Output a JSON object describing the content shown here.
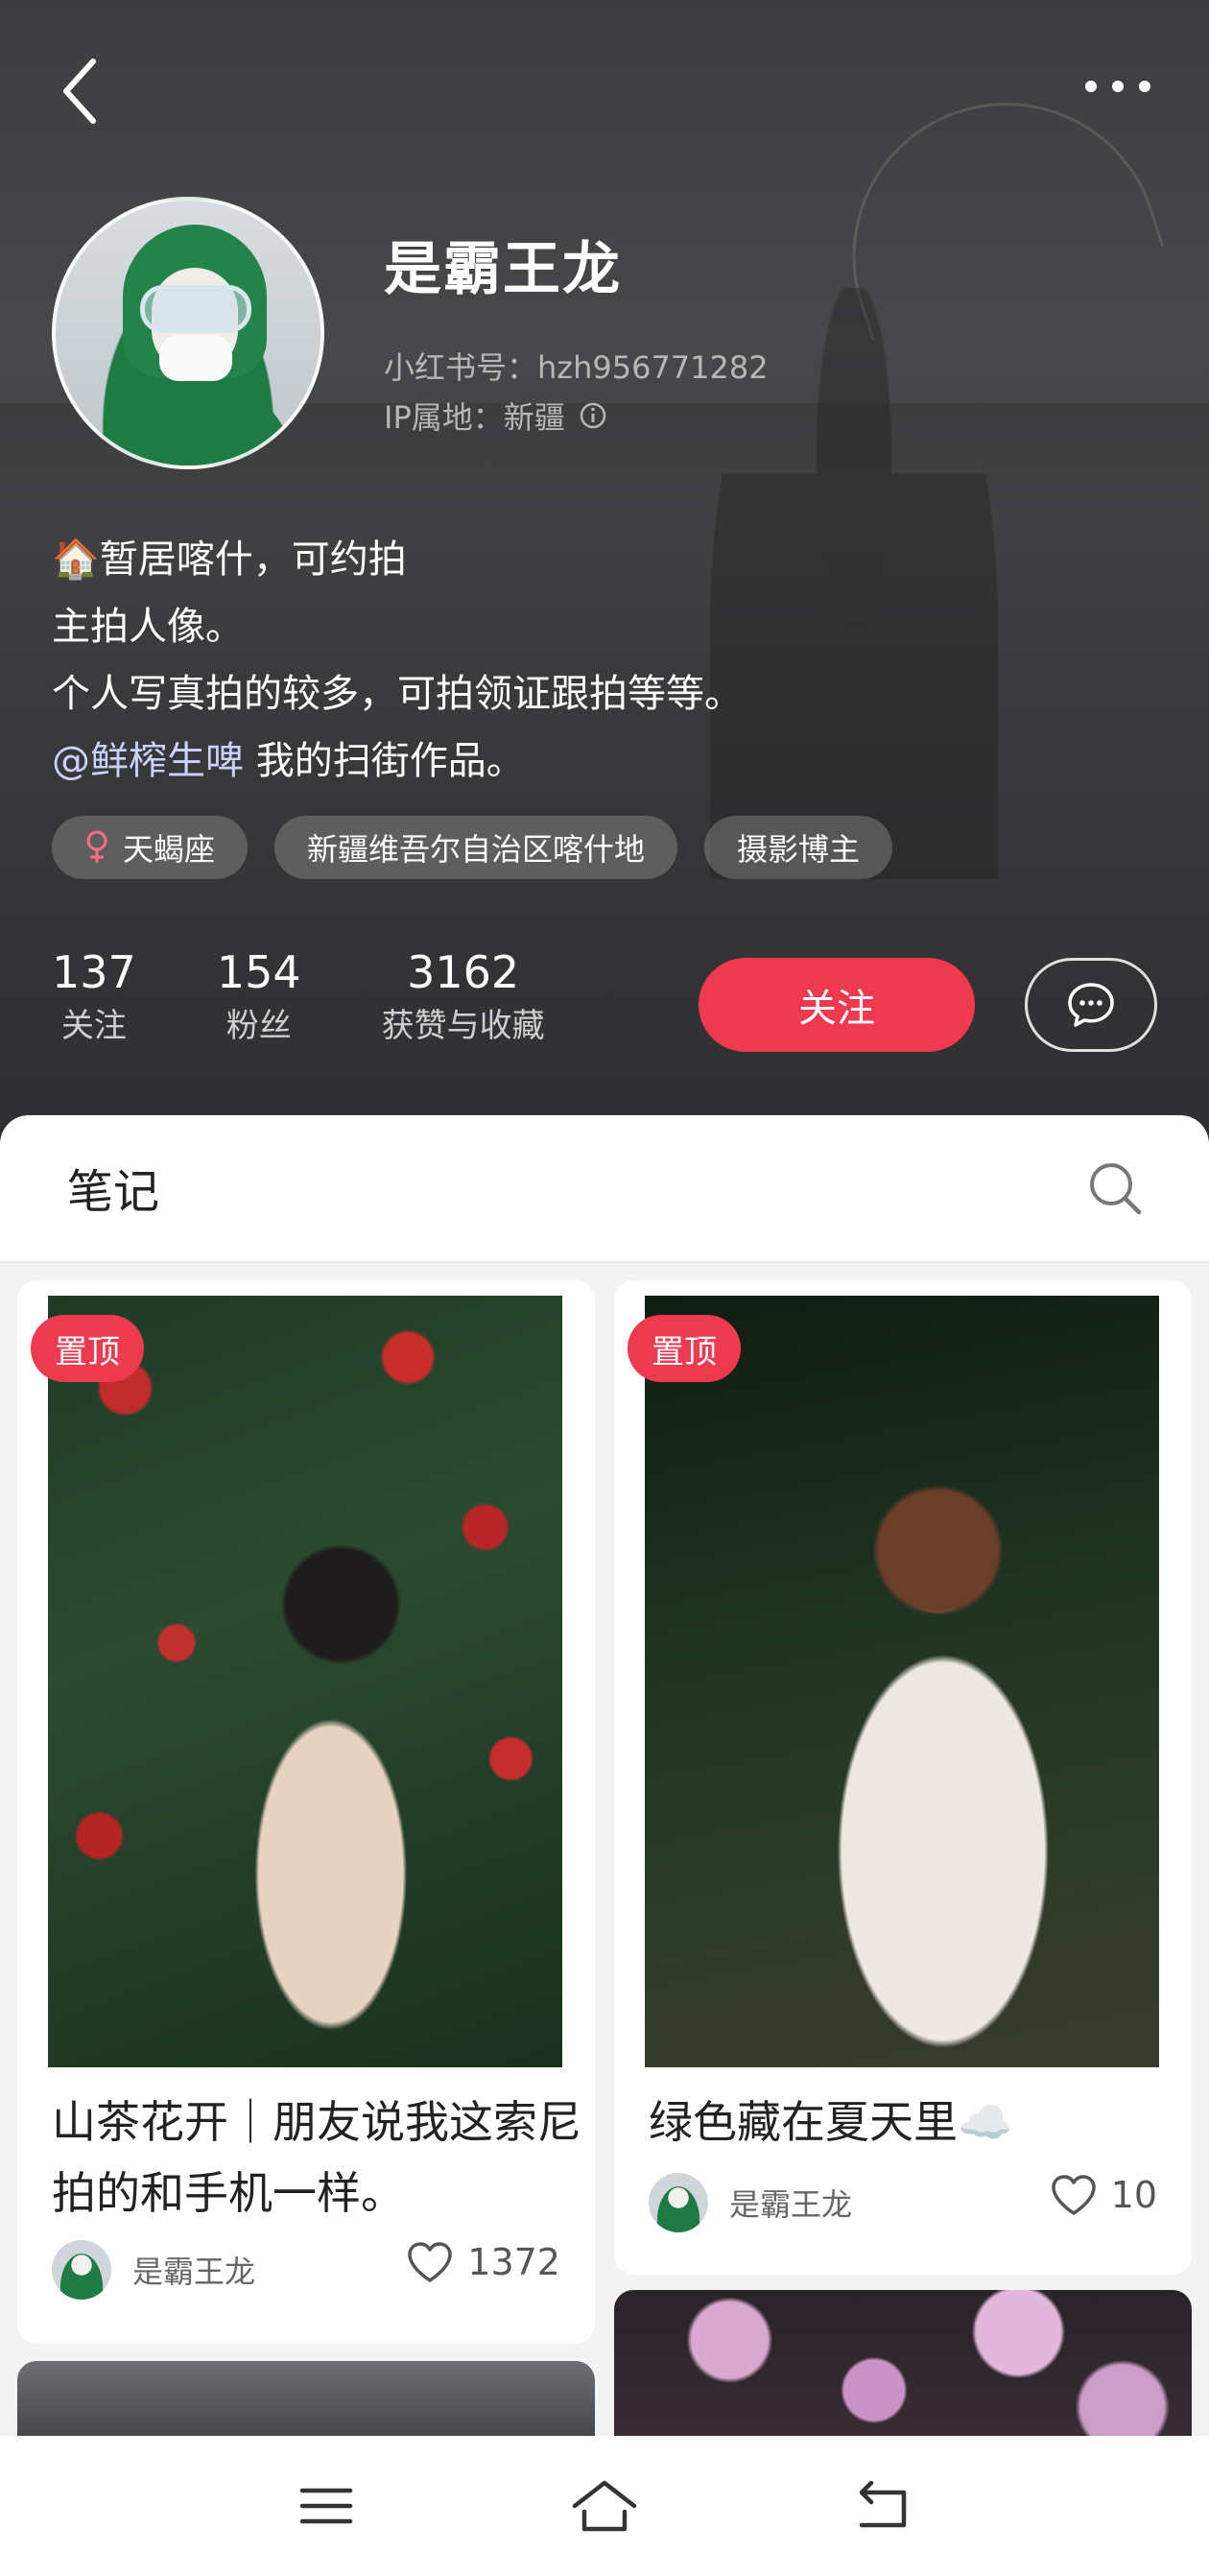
{
  "header": {
    "name": "是霸王龙",
    "xhs_id_label": "小红书号：hzh956771282",
    "ip_label": "IP属地：新疆",
    "bio": [
      "🏠暂居喀什，可约拍",
      "主拍人像。",
      "个人写真拍的较多，可拍领证跟拍等等。"
    ],
    "bio_mention": "@鲜榨生啤",
    "bio_mention_suffix": " 我的扫街作品。",
    "tags": {
      "zodiac": "天蝎座",
      "location": "新疆维吾尔自治区喀什地",
      "role": "摄影博主"
    },
    "stats": {
      "following_count": "137",
      "following_label": "关注",
      "followers_count": "154",
      "followers_label": "粉丝",
      "likes_count": "3162",
      "likes_label": "获赞与收藏"
    },
    "follow_label": "关注"
  },
  "notes": {
    "title": "笔记",
    "cards": [
      {
        "pin": "置顶",
        "title": "山茶花开｜朋友说我这索尼拍的和手机一样。",
        "author": "是霸王龙",
        "likes": "1372"
      },
      {
        "pin": "置顶",
        "title": "绿色藏在夏天里☁️",
        "author": "是霸王龙",
        "likes": "10"
      }
    ]
  },
  "icons": {
    "back": "chevron-left-icon",
    "more": "more-horizontal-icon",
    "info": "info-icon",
    "female": "female-icon",
    "chat": "chat-bubble-icon",
    "search": "search-icon",
    "heart": "heart-icon",
    "menu": "menu-icon",
    "home": "home-icon",
    "return": "return-icon"
  },
  "colors": {
    "accent": "#ee3a4f",
    "header_bg": "#3d3d3f"
  }
}
